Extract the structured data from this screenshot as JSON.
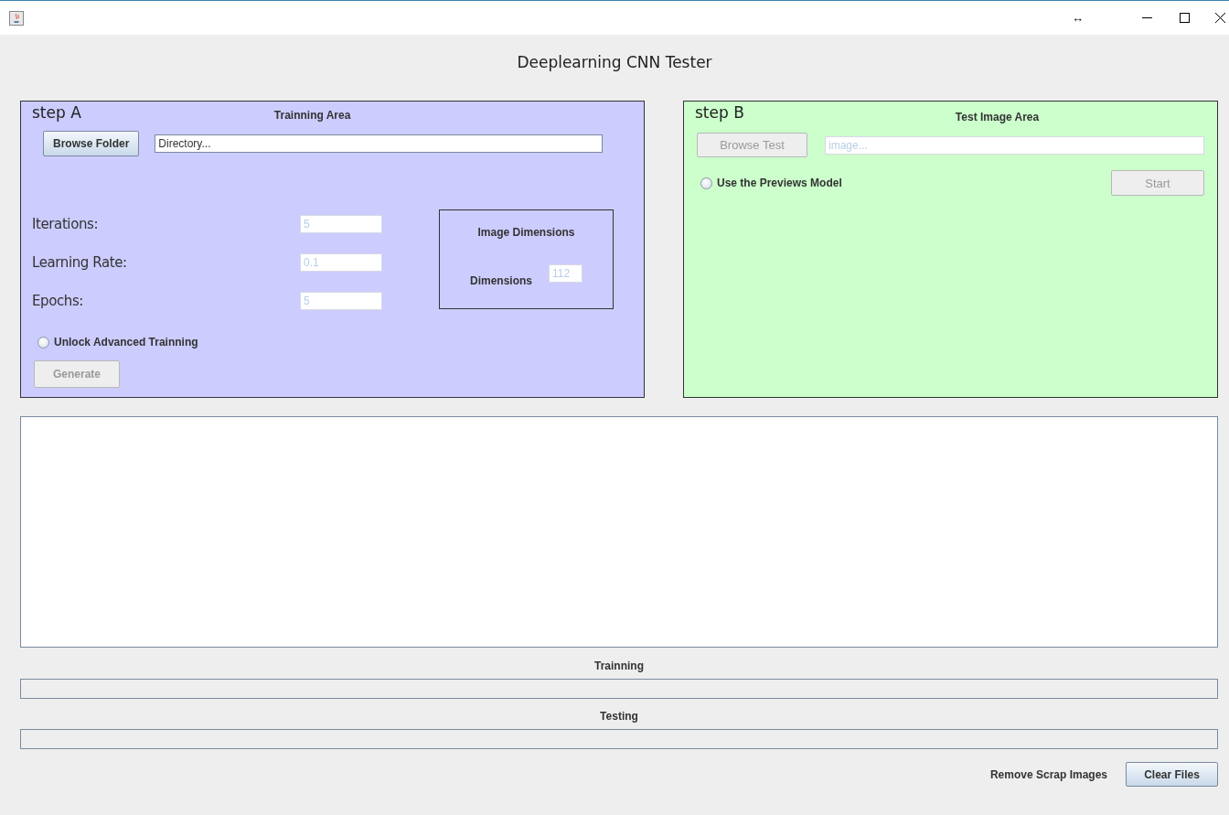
{
  "window": {
    "resize_glyph": "↔"
  },
  "title": "Deeplearning CNN Tester",
  "step_a": {
    "step": "step A",
    "title": "Trainning Area",
    "browse_button": {
      "label": "Browse Folder",
      "disabled": false
    },
    "directory_field": {
      "value": "Directory...",
      "disabled": false
    },
    "fields": [
      {
        "label": "Iterations:",
        "value": "5",
        "disabled": true
      },
      {
        "label": "Learning Rate:",
        "value": "0.1",
        "disabled": true
      },
      {
        "label": "Epochs:",
        "value": "5",
        "disabled": true
      }
    ],
    "image_dimensions": {
      "title": "Image Dimensions",
      "label": "Dimensions",
      "value": "112",
      "disabled": true
    },
    "advanced_radio": {
      "label": "Unlock Advanced Trainning",
      "checked": false
    },
    "generate_button": {
      "label": "Generate",
      "disabled": true
    }
  },
  "step_b": {
    "step": "step B",
    "title": "Test Image Area",
    "browse_button": {
      "label": "Browse Test",
      "disabled": true
    },
    "image_field": {
      "value": "image...",
      "disabled": true
    },
    "previous_model_radio": {
      "label": "Use the Previews Model",
      "checked": false
    },
    "start_button": {
      "label": "Start",
      "disabled": true
    }
  },
  "progress": [
    {
      "label": "Trainning",
      "level": 0
    },
    {
      "label": "Testing",
      "level": 0
    }
  ],
  "footer": {
    "label": "Remove Scrap Images",
    "clear_button": {
      "label": "Clear Files",
      "disabled": false
    }
  }
}
